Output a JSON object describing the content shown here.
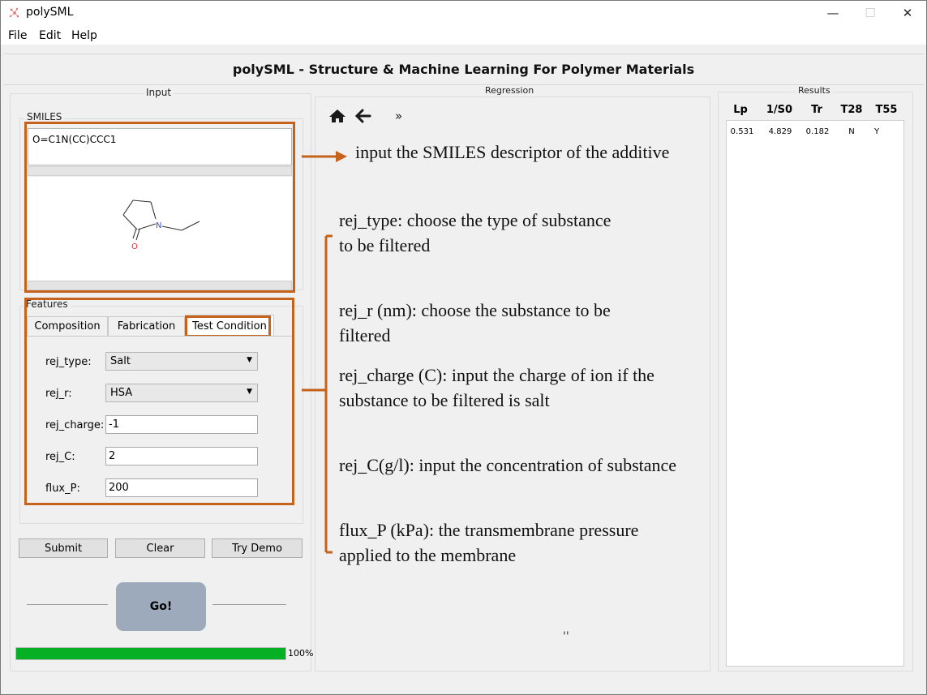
{
  "window": {
    "title": "polySML",
    "minimize": "—",
    "maximize": "☐",
    "close": "✕"
  },
  "menu": {
    "items": [
      "File",
      "Edit",
      "Help"
    ]
  },
  "header": {
    "title": "polySML - Structure & Machine Learning For Polymer Materials"
  },
  "input_group": {
    "title": "Input",
    "smiles_label": "SMILES",
    "smiles_value": "O=C1N(CC)CCC1",
    "molecule": {
      "atom_N": "N",
      "atom_O": "O"
    }
  },
  "features": {
    "title": "Features",
    "tabs": [
      "Composition",
      "Fabrication",
      "Test Condition"
    ],
    "active_tab": "Test Condition",
    "fields": [
      {
        "label": "rej_type:",
        "value": "Salt",
        "kind": "combo"
      },
      {
        "label": "rej_r:",
        "value": "HSA",
        "kind": "combo"
      },
      {
        "label": "rej_charge:",
        "value": "-1",
        "kind": "text"
      },
      {
        "label": "rej_C:",
        "value": "2",
        "kind": "text"
      },
      {
        "label": "flux_P:",
        "value": "200",
        "kind": "text"
      }
    ]
  },
  "buttons": {
    "submit": "Submit",
    "clear": "Clear",
    "demo": "Try Demo",
    "go": "Go!"
  },
  "progress": {
    "value": 100,
    "label": "100%",
    "color": "#06b025"
  },
  "regression": {
    "title": "Regression",
    "toolbar": {
      "home_icon": "home-icon",
      "back_icon": "back-arrow-icon",
      "more": "»"
    },
    "stray_mark": "''"
  },
  "results": {
    "title": "Results",
    "columns": [
      "Lp",
      "1/S0",
      "Tr",
      "T28",
      "T55"
    ],
    "rows": [
      [
        "0.531",
        "4.829",
        "0.182",
        "N",
        "Y"
      ]
    ]
  },
  "annotations": {
    "smiles": "input the SMILES descriptor of the additive",
    "rej_type": [
      "rej_type: choose the type of substance",
      "to be filtered"
    ],
    "rej_r": [
      "rej_r (nm): choose the substance to be",
      "filtered"
    ],
    "rej_charge": [
      "rej_charge (C): input the charge of ion if the",
      "substance to be filtered is salt"
    ],
    "rej_C": [
      "rej_C(g/l): input the concentration of substance"
    ],
    "flux_P": [
      "flux_P (kPa): the transmembrane pressure",
      "applied to the membrane"
    ],
    "accent_color": "#c5631d"
  }
}
